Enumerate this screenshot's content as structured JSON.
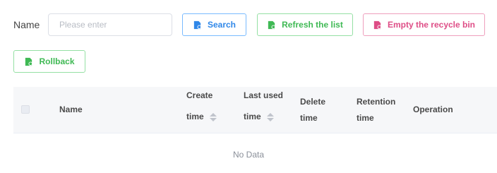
{
  "filter": {
    "name_label": "Name",
    "name_placeholder": "Please enter"
  },
  "buttons": {
    "search": "Search",
    "refresh": "Refresh the list",
    "empty": "Empty the recycle bin",
    "rollback": "Rollback"
  },
  "colors": {
    "search": "#2f87e8",
    "refresh": "#3fb954",
    "empty": "#de4d86"
  },
  "icons": {
    "search": "document-icon",
    "refresh": "document-icon",
    "empty": "document-icon",
    "rollback": "document-icon"
  },
  "table": {
    "columns": {
      "name": "Name",
      "create_time_1": "Create",
      "create_time_2": "time",
      "last_used_1": "Last used",
      "last_used_2": "time",
      "delete_time_1": "Delete",
      "delete_time_2": "time",
      "retention_1": "Retention",
      "retention_2": "time",
      "operation": "Operation"
    },
    "empty_text": "No Data"
  }
}
